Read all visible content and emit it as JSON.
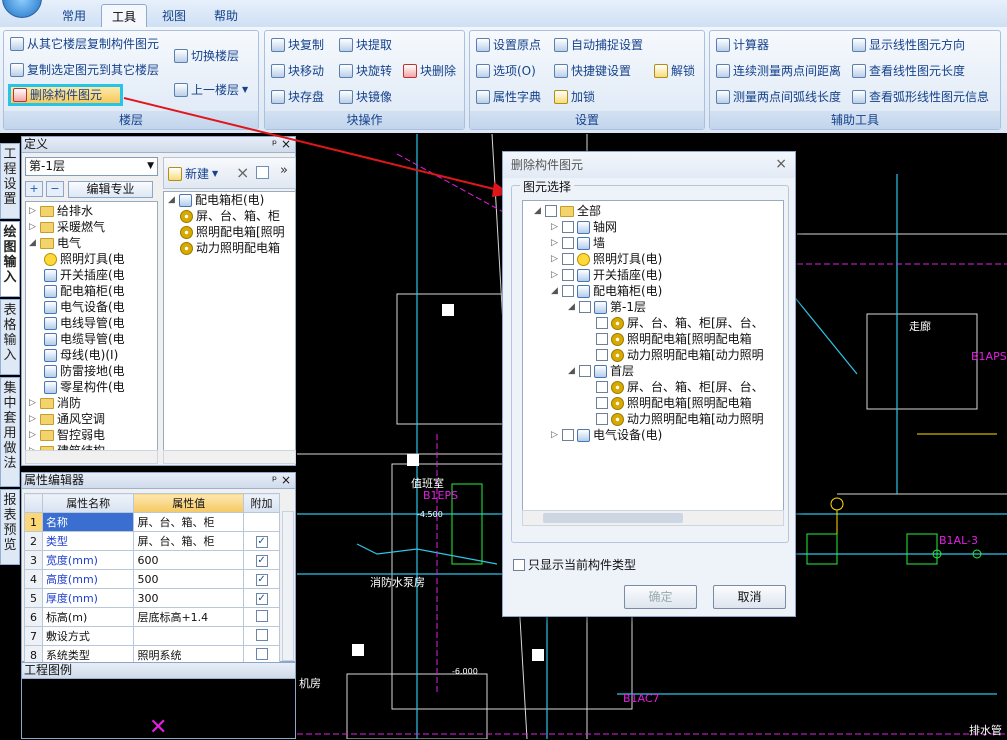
{
  "tabs": [
    "常用",
    "工具",
    "视图",
    "帮助"
  ],
  "ribbon": {
    "floor_group": {
      "label": "楼层",
      "items": [
        "从其它楼层复制构件图元",
        "复制选定图元到其它楼层",
        "删除构件图元",
        "切换楼层",
        "上一楼层"
      ]
    },
    "block_group": {
      "label": "块操作",
      "items": [
        "块复制",
        "块提取",
        "块移动",
        "块旋转",
        "块删除",
        "块存盘",
        "块镜像"
      ]
    },
    "settings_group": {
      "label": "设置",
      "items": [
        "设置原点",
        "自动捕捉设置",
        "选项(O)",
        "快捷键设置",
        "解锁",
        "属性字典",
        "加锁"
      ]
    },
    "aux_group": {
      "label": "辅助工具",
      "items": [
        "计算器",
        "显示线性图元方向",
        "连续测量两点间距离",
        "查看线性图元长度",
        "测量两点间弧线长度",
        "查看弧形线性图元信息"
      ]
    }
  },
  "vertical_tabs": [
    "工程设置",
    "绘图输入",
    "表格输入",
    "集中套用做法",
    "报表预览"
  ],
  "definition_panel": {
    "title": "定义",
    "floor": "第-1层",
    "edit_specialty": "编辑专业",
    "tree": [
      {
        "label": "给排水",
        "level": 0,
        "kind": "folder",
        "state": "+"
      },
      {
        "label": "采暖燃气",
        "level": 0,
        "kind": "folder",
        "state": "+"
      },
      {
        "label": "电气",
        "level": 0,
        "kind": "folder",
        "state": "-"
      },
      {
        "label": "照明灯具(电",
        "level": 1,
        "kind": "bulb"
      },
      {
        "label": "开关插座(电",
        "level": 1,
        "kind": "switch"
      },
      {
        "label": "配电箱柜(电",
        "level": 1,
        "kind": "box"
      },
      {
        "label": "电气设备(电",
        "level": 1,
        "kind": "device"
      },
      {
        "label": "电线导管(电",
        "level": 1,
        "kind": "pipe"
      },
      {
        "label": "电缆导管(电",
        "level": 1,
        "kind": "cable"
      },
      {
        "label": "母线(电)(I)",
        "level": 1,
        "kind": "bus"
      },
      {
        "label": "防雷接地(电",
        "level": 1,
        "kind": "lightning"
      },
      {
        "label": "零星构件(电",
        "level": 1,
        "kind": "misc"
      },
      {
        "label": "消防",
        "level": 0,
        "kind": "folder",
        "state": "+"
      },
      {
        "label": "通风空调",
        "level": 0,
        "kind": "folder",
        "state": "+"
      },
      {
        "label": "智控弱电",
        "level": 0,
        "kind": "folder",
        "state": "+"
      },
      {
        "label": "建筑结构",
        "level": 0,
        "kind": "folder",
        "state": "+"
      }
    ]
  },
  "component_panel": {
    "new_label": "新建",
    "root": "配电箱柜(电)",
    "items": [
      "屏、台、箱、柜",
      "照明配电箱[照明",
      "动力照明配电箱"
    ]
  },
  "property_panel": {
    "title": "属性编辑器",
    "headers": [
      "属性名称",
      "属性值",
      "附加"
    ],
    "rows": [
      {
        "no": "1",
        "name": "名称",
        "value": "屏、台、箱、柜",
        "checked": null
      },
      {
        "no": "2",
        "name": "类型",
        "value": "屏、台、箱、柜",
        "checked": true
      },
      {
        "no": "3",
        "name": "宽度(mm)",
        "value": "600",
        "checked": true
      },
      {
        "no": "4",
        "name": "高度(mm)",
        "value": "500",
        "checked": true
      },
      {
        "no": "5",
        "name": "厚度(mm)",
        "value": "300",
        "checked": true
      },
      {
        "no": "6",
        "name": "标高(m)",
        "value": "层底标高+1.4",
        "checked": false
      },
      {
        "no": "7",
        "name": "敷设方式",
        "value": "",
        "checked": false
      },
      {
        "no": "8",
        "name": "系统类型",
        "value": "照明系统",
        "checked": false
      }
    ]
  },
  "legend_panel": {
    "title": "工程图例"
  },
  "dialog": {
    "title": "删除构件图元",
    "close": "×",
    "group_label": "图元选择",
    "tree": [
      {
        "label": "全部",
        "level": 0,
        "exp": "-",
        "kind": "folder"
      },
      {
        "label": "轴网",
        "level": 1,
        "exp": "+",
        "kind": "grid"
      },
      {
        "label": "墙",
        "level": 1,
        "exp": "+",
        "kind": "wall"
      },
      {
        "label": "照明灯具(电)",
        "level": 1,
        "exp": "+",
        "kind": "bulb"
      },
      {
        "label": "开关插座(电)",
        "level": 1,
        "exp": "+",
        "kind": "switch"
      },
      {
        "label": "配电箱柜(电)",
        "level": 1,
        "exp": "-",
        "kind": "box"
      },
      {
        "label": "第-1层",
        "level": 2,
        "exp": "-",
        "kind": "floor"
      },
      {
        "label": "屏、台、箱、柜[屏、台、",
        "level": 3,
        "exp": "",
        "kind": "gear"
      },
      {
        "label": "照明配电箱[照明配电箱",
        "level": 3,
        "exp": "",
        "kind": "gear"
      },
      {
        "label": "动力照明配电箱[动力照明",
        "level": 3,
        "exp": "",
        "kind": "gear"
      },
      {
        "label": "首层",
        "level": 2,
        "exp": "-",
        "kind": "floor"
      },
      {
        "label": "屏、台、箱、柜[屏、台、",
        "level": 3,
        "exp": "",
        "kind": "gear"
      },
      {
        "label": "照明配电箱[照明配电箱",
        "level": 3,
        "exp": "",
        "kind": "gear"
      },
      {
        "label": "动力照明配电箱[动力照明",
        "level": 3,
        "exp": "",
        "kind": "gear"
      },
      {
        "label": "电气设备(电)",
        "level": 1,
        "exp": "+",
        "kind": "device"
      }
    ],
    "only_current_label": "只显示当前构件类型",
    "ok": "确定",
    "cancel": "取消"
  },
  "cad_labels": [
    "值班室",
    "B1EPS",
    "-4.500",
    "消防水泵房",
    "机房",
    "-6.000",
    "走廊",
    "B1APS",
    "B1AL-3",
    "B1AC7",
    "排水管"
  ],
  "colors": {
    "highlight": "#27c4e8",
    "arrow": "#e0161b",
    "cad_bg": "#000000"
  }
}
